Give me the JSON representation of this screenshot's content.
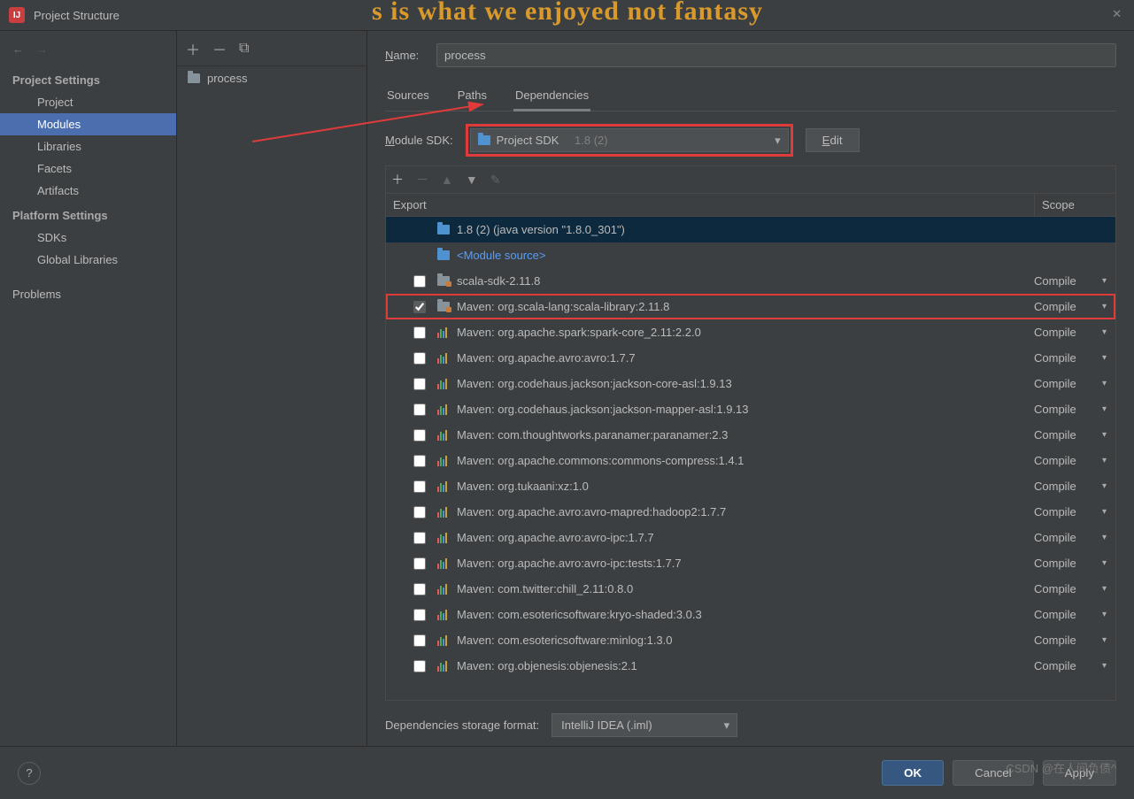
{
  "title": "Project Structure",
  "fantasyText": "s is what we enjoyed not fantasy",
  "leftNav": {
    "section1": "Project Settings",
    "items1": [
      "Project",
      "Modules",
      "Libraries",
      "Facets",
      "Artifacts"
    ],
    "section2": "Platform Settings",
    "items2": [
      "SDKs",
      "Global Libraries"
    ],
    "problems": "Problems"
  },
  "midItem": "process",
  "nameLabel": "Name:",
  "nameValue": "process",
  "tabs": [
    "Sources",
    "Paths",
    "Dependencies"
  ],
  "sdkLabel": "Module SDK:",
  "sdkValue": "Project SDK",
  "sdkVer": "1.8 (2)",
  "editLabel": "Edit",
  "exportLabel": "Export",
  "scopeLabel": "Scope",
  "deps": [
    {
      "chk": null,
      "icon": "folder-blue",
      "txt": "1.8 (2) (java version \"1.8.0_301\")",
      "scope": "",
      "sel": true
    },
    {
      "chk": null,
      "icon": "folder-blue",
      "txt": "<Module source>",
      "scope": "",
      "link": true
    },
    {
      "chk": false,
      "icon": "folder-orange",
      "txt": "scala-sdk-2.11.8",
      "scope": "Compile"
    },
    {
      "chk": true,
      "icon": "folder-orange",
      "txt": "Maven: org.scala-lang:scala-library:2.11.8",
      "scope": "Compile",
      "hl": true
    },
    {
      "chk": false,
      "icon": "bars",
      "txt": "Maven: org.apache.spark:spark-core_2.11:2.2.0",
      "scope": "Compile"
    },
    {
      "chk": false,
      "icon": "bars",
      "txt": "Maven: org.apache.avro:avro:1.7.7",
      "scope": "Compile"
    },
    {
      "chk": false,
      "icon": "bars",
      "txt": "Maven: org.codehaus.jackson:jackson-core-asl:1.9.13",
      "scope": "Compile"
    },
    {
      "chk": false,
      "icon": "bars",
      "txt": "Maven: org.codehaus.jackson:jackson-mapper-asl:1.9.13",
      "scope": "Compile"
    },
    {
      "chk": false,
      "icon": "bars",
      "txt": "Maven: com.thoughtworks.paranamer:paranamer:2.3",
      "scope": "Compile"
    },
    {
      "chk": false,
      "icon": "bars",
      "txt": "Maven: org.apache.commons:commons-compress:1.4.1",
      "scope": "Compile"
    },
    {
      "chk": false,
      "icon": "bars",
      "txt": "Maven: org.tukaani:xz:1.0",
      "scope": "Compile"
    },
    {
      "chk": false,
      "icon": "bars",
      "txt": "Maven: org.apache.avro:avro-mapred:hadoop2:1.7.7",
      "scope": "Compile"
    },
    {
      "chk": false,
      "icon": "bars",
      "txt": "Maven: org.apache.avro:avro-ipc:1.7.7",
      "scope": "Compile"
    },
    {
      "chk": false,
      "icon": "bars",
      "txt": "Maven: org.apache.avro:avro-ipc:tests:1.7.7",
      "scope": "Compile"
    },
    {
      "chk": false,
      "icon": "bars",
      "txt": "Maven: com.twitter:chill_2.11:0.8.0",
      "scope": "Compile"
    },
    {
      "chk": false,
      "icon": "bars",
      "txt": "Maven: com.esotericsoftware:kryo-shaded:3.0.3",
      "scope": "Compile"
    },
    {
      "chk": false,
      "icon": "bars",
      "txt": "Maven: com.esotericsoftware:minlog:1.3.0",
      "scope": "Compile"
    },
    {
      "chk": false,
      "icon": "bars",
      "txt": "Maven: org.objenesis:objenesis:2.1",
      "scope": "Compile"
    }
  ],
  "storageLabel": "Dependencies storage format:",
  "storageValue": "IntelliJ IDEA (.iml)",
  "btnOk": "OK",
  "btnCancel": "Cancel",
  "btnApply": "Apply",
  "watermark": "CSDN @在人间负债^"
}
